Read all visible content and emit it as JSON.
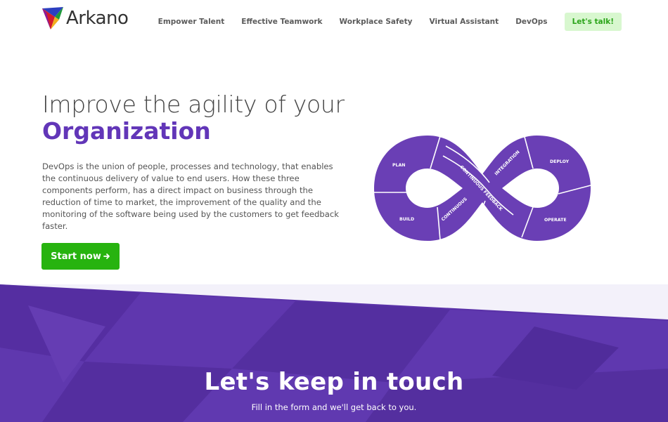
{
  "brand": {
    "name": "Arkano"
  },
  "nav": {
    "items": [
      {
        "label": "Empower Talent"
      },
      {
        "label": "Effective Teamwork"
      },
      {
        "label": "Workplace Safety"
      },
      {
        "label": "Virtual Assistant"
      },
      {
        "label": "DevOps"
      }
    ],
    "cta_label": "Let's talk!"
  },
  "hero": {
    "title_line1": "Improve the agility of your",
    "title_line2": "Organization",
    "description": "DevOps is the union of people, processes and technology, that enables the continuous delivery of value to end users. How these three components perform, has a direct impact on business through the reduction of time to market, the improvement of the quality and the monitoring of the software being used by the customers to get feedback faster.",
    "button_label": "Start now",
    "button_icon": "arrow-right-icon"
  },
  "devops_loop": {
    "labels": {
      "plan": "PLAN",
      "build": "BUILD",
      "continuous": "CONTINUOUS",
      "continuous_feedback": "CONTINUOUS FEEDBACK",
      "integration": "INTEGRATION",
      "deploy": "DEPLOY",
      "operate": "OPERATE"
    }
  },
  "contact": {
    "title": "Let's keep in touch",
    "subtitle": "Fill in the form and we'll get back to you."
  },
  "colors": {
    "brand_purple": "#6236b8",
    "loop_purple": "#6a3fb5",
    "cta_green": "#27b30f",
    "cta_light_bg": "#d8f7cf",
    "section_purple": "#5a32a8"
  }
}
